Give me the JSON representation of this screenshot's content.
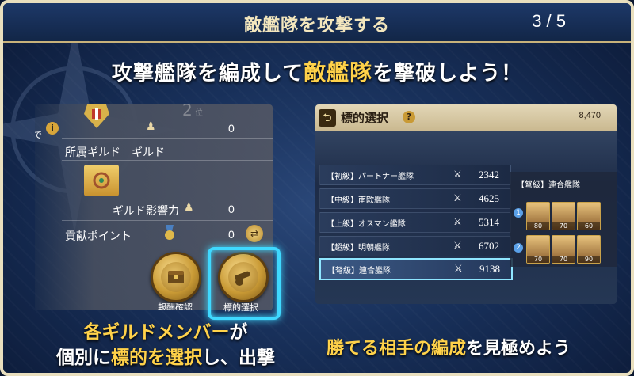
{
  "header": {
    "title": "敵艦隊を攻撃する",
    "counter": "3 / 5"
  },
  "headline": {
    "pre": "攻撃艦隊を編成して",
    "highlight": "敵艦隊",
    "post": "を撃破しよう！"
  },
  "left_panel": {
    "row1_value": "0",
    "guild_label": "所属ギルド　ギルド",
    "influence_label": "ギルド影響力",
    "influence_value": "0",
    "contribution_label": "貢献ポイント",
    "contribution_value": "0",
    "edge_char": "で",
    "btn_reward": "報酬確認",
    "btn_target": "標的選択"
  },
  "caption_left": {
    "line1_pre": "各ギルドメンバー",
    "line1_post": "が",
    "line2_pre": "個別に",
    "line2_hl": "標的を選択",
    "line2_post": "し、出撃"
  },
  "caption_right": {
    "hl1": "勝てる相手の編成",
    "post": "を見極めよう"
  },
  "right_panel": {
    "title": "標的選択",
    "coins": "8,470",
    "targets": [
      {
        "name": "【初級】パートナー艦隊",
        "power": "2342"
      },
      {
        "name": "【中級】南欧艦隊",
        "power": "4625"
      },
      {
        "name": "【上級】オスマン艦隊",
        "power": "5314"
      },
      {
        "name": "【超級】明朝艦隊",
        "power": "6702"
      },
      {
        "name": "【弩級】連合艦隊",
        "power": "9138"
      }
    ],
    "selected_label": "【弩級】連合艦隊",
    "fleet1_levels": [
      "80",
      "70",
      "60"
    ],
    "fleet2_levels": [
      "70",
      "70",
      "90"
    ]
  },
  "colors": {
    "accent": "#ffd24a",
    "highlight_border": "#3fd9ff",
    "frame": "#e9dfbe"
  }
}
